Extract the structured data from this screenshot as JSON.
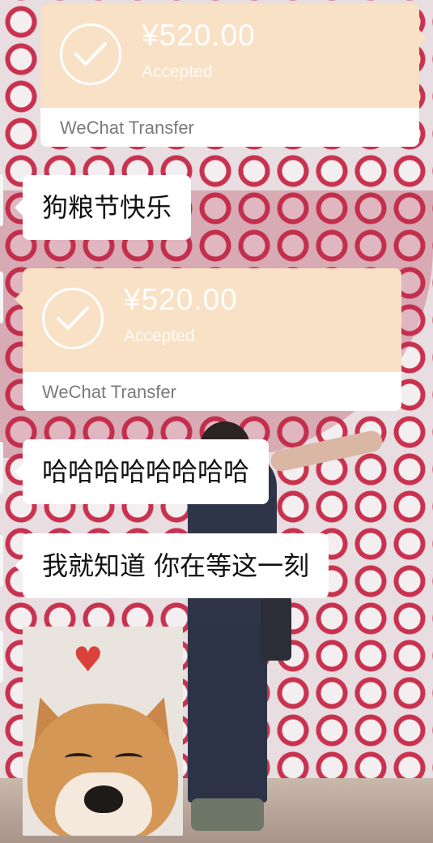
{
  "messages": [
    {
      "type": "transfer",
      "amount": "¥520.00",
      "status": "Accepted",
      "label": "WeChat Transfer",
      "side": "right"
    },
    {
      "type": "text",
      "text": "狗粮节快乐",
      "side": "left"
    },
    {
      "type": "transfer",
      "amount": "¥520.00",
      "status": "Accepted",
      "label": "WeChat Transfer",
      "side": "left"
    },
    {
      "type": "text",
      "text": "哈哈哈哈哈哈哈哈",
      "side": "left"
    },
    {
      "type": "text",
      "text": "我就知道 你在等这一刻",
      "side": "left"
    },
    {
      "type": "sticker",
      "icon": "shiba-dog-heart-sticker",
      "side": "left"
    }
  ],
  "colors": {
    "transfer_accent": "#f9e1c6",
    "bubble_bg": "#ffffff",
    "transfer_label": "#7a7a7a",
    "heart": "#d9413a"
  },
  "icons": {
    "accepted": "check-circle-icon",
    "sticker_heart": "heart-icon"
  }
}
